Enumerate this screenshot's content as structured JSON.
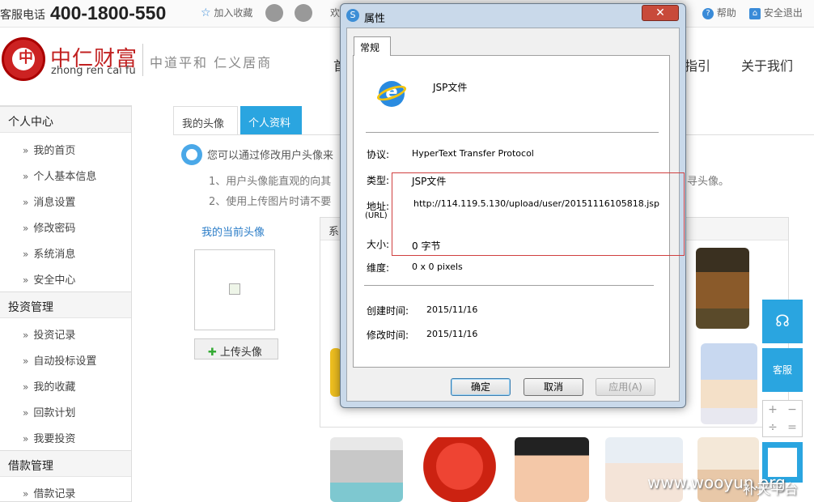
{
  "topbar": {
    "phone_label": "客服电话",
    "phone_number": "400-1800-550",
    "favorite": "加入收藏",
    "welcome_partial": "欢",
    "help": "帮助",
    "logout": "安全退出"
  },
  "brand": {
    "logo_char": "中",
    "name_cn": "中仁财富",
    "name_en": "zhong ren cai fu",
    "slogan": "中道平和  仁义居商"
  },
  "nav": {
    "item_partial_left": "首",
    "item_partial_right": "指引",
    "about": "关于我们"
  },
  "sidebar": {
    "groups": [
      {
        "title": "个人中心",
        "items": [
          "我的首页",
          "个人基本信息",
          "消息设置",
          "修改密码",
          "系统消息",
          "安全中心"
        ]
      },
      {
        "title": "投资管理",
        "items": [
          "投资记录",
          "自动投标设置",
          "我的收藏",
          "回款计划",
          "我要投资"
        ]
      },
      {
        "title": "借款管理",
        "items": [
          "借款记录"
        ]
      }
    ],
    "arrow": "»"
  },
  "main": {
    "tab_avatar": "我的头像",
    "tab_profile": "个人资料",
    "tip": "您可以通过修改用户头像来",
    "tip_line1": "1、用户头像能直观的向其",
    "tip_line1_tail": "寻头像。",
    "tip_line2": "2、使用上传图片时请不要",
    "current_avatar": "我的当前头像",
    "upload": "上传头像",
    "gallery_title_partial": "系"
  },
  "float": {
    "service": "客服",
    "zoom_in": "+",
    "zoom_out": "−",
    "zoom_eq": "=",
    "zoom_div": "÷"
  },
  "watermark": "www.wooyun.org",
  "watermark2": "补天平台",
  "dialog": {
    "title": "属性",
    "close": "✕",
    "tab": "常规",
    "file_type_title": "JSP文件",
    "protocol_label": "协议:",
    "protocol_value": "HyperText Transfer Protocol",
    "type_label": "类型:",
    "type_value": "JSP文件",
    "address_label": "地址:",
    "address_sub": "(URL)",
    "address_value": "http://114.119.5.130/upload/user/20151116105818.jsp",
    "size_label": "大小:",
    "size_value": "0 字节",
    "dims_label": "维度:",
    "dims_value": "0  x  0  pixels",
    "created_label": "创建时间:",
    "created_value": "2015/11/16",
    "modified_label": "修改时间:",
    "modified_value": "2015/11/16",
    "ok": "确定",
    "cancel": "取消",
    "apply": "应用(A)"
  }
}
